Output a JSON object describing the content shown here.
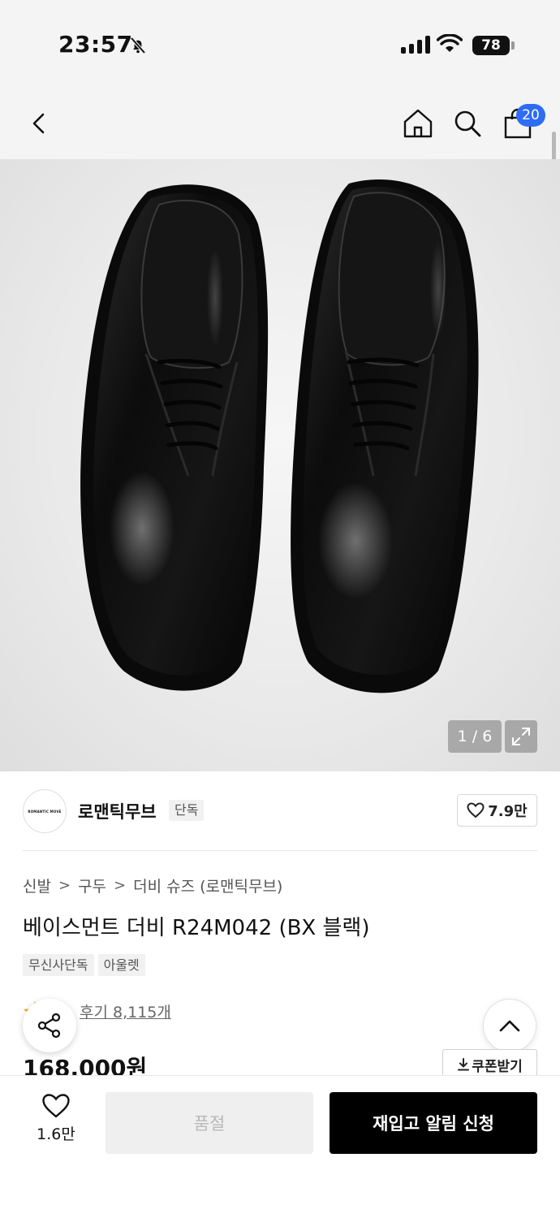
{
  "status_bar": {
    "time": "23:57",
    "battery": "78"
  },
  "nav": {
    "cart_count": "20"
  },
  "gallery": {
    "page_counter": "1 / 6"
  },
  "brand": {
    "logo_text": "ROMANTIC MOVE",
    "name": "로맨틱무브",
    "tag": "단독",
    "likes": "7.9만"
  },
  "breadcrumb": [
    "신발",
    "구두",
    "더비 슈즈 (로맨틱무브)"
  ],
  "product": {
    "title": "베이스먼트 더비 R24M042 (BX 블랙)",
    "tags": [
      "무신사단독",
      "아울렛"
    ],
    "review_link": "후기 8,115개",
    "price": "168,000원",
    "coupon_label": "쿠폰받기"
  },
  "bottom_bar": {
    "wish_count": "1.6만",
    "soldout_label": "품절",
    "restock_label": "재입고 알림 신청"
  },
  "colors": {
    "accent_badge": "#2f6cf6",
    "primary_button": "#000000",
    "disabled_button": "#efefef"
  }
}
